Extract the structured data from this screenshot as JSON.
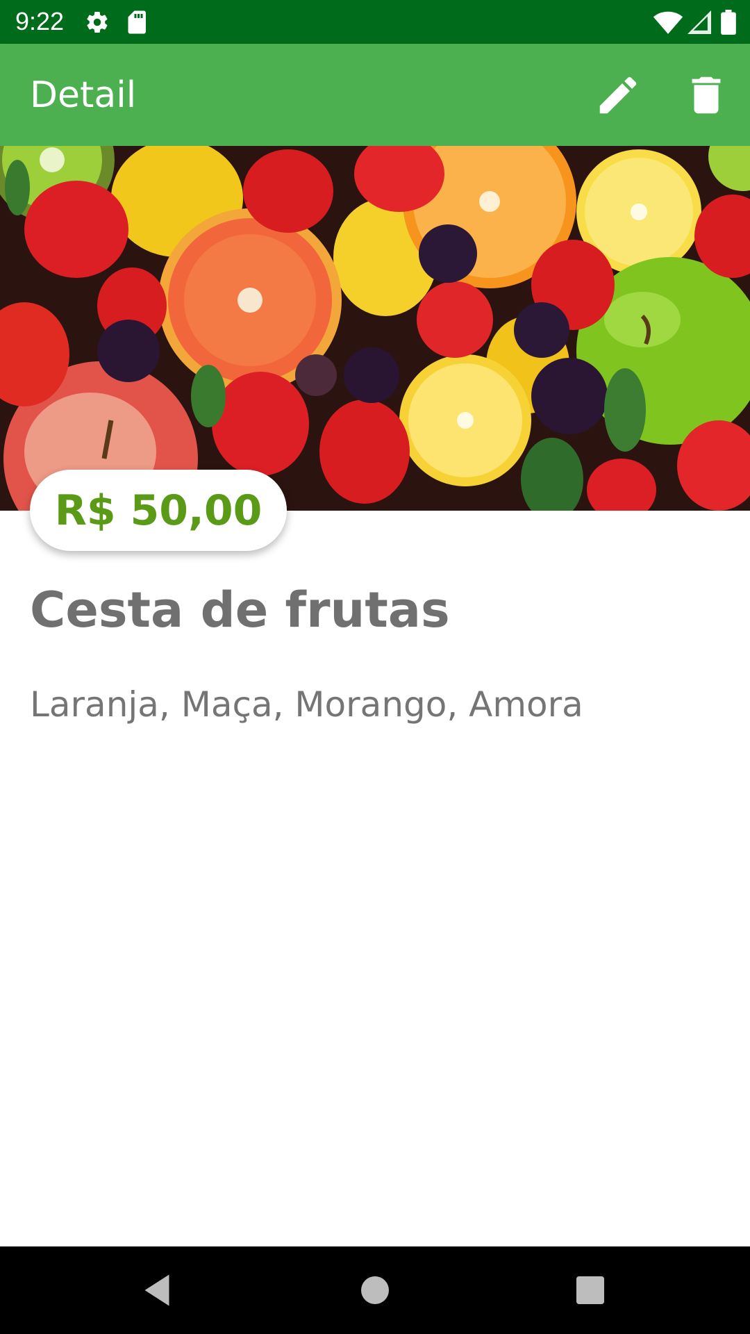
{
  "status_bar": {
    "time": "9:22",
    "icons": [
      "settings-icon",
      "sd-card-icon",
      "wifi-icon",
      "signal-icon",
      "battery-icon"
    ],
    "background": "#006b1b"
  },
  "app_bar": {
    "title": "Detail",
    "actions": [
      "edit-icon",
      "delete-icon"
    ],
    "background": "#4caf50"
  },
  "product": {
    "image_alt": "fruits",
    "price": "R$ 50,00",
    "name": "Cesta de frutas",
    "description": "Laranja, Maça, Morango, Amora",
    "price_color": "#5a9a16"
  },
  "nav_bar": {
    "buttons": [
      "back-icon",
      "home-icon",
      "recents-icon"
    ]
  }
}
